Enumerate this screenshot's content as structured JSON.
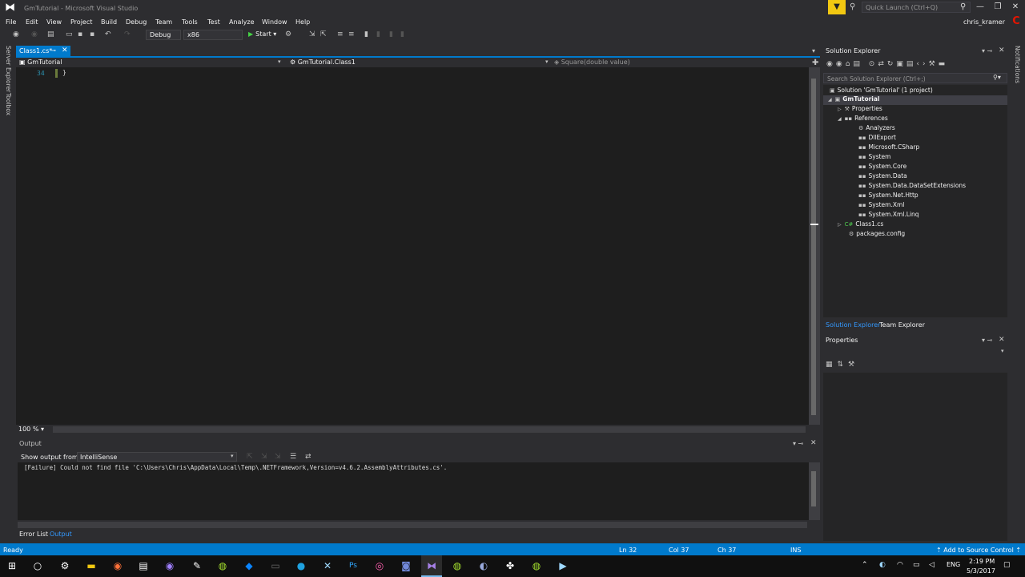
{
  "window": {
    "title": "GmTutorial - Microsoft Visual Studio",
    "quick_launch_placeholder": "Quick Launch (Ctrl+Q)"
  },
  "menu": [
    "File",
    "Edit",
    "View",
    "Project",
    "Build",
    "Debug",
    "Team",
    "Tools",
    "Test",
    "Analyze",
    "Window",
    "Help"
  ],
  "account": {
    "user": "chris_kramer"
  },
  "toolbar": {
    "configuration": "Debug",
    "platform": "x86",
    "start_label": "Start"
  },
  "left_strip": {
    "server_explorer": "Server Explorer",
    "toolbox": "Toolbox"
  },
  "editor": {
    "tab_label": "Class1.cs*",
    "nav_project": "GmTutorial",
    "nav_class": "GmTutorial.Class1",
    "nav_member": "Square(double value)",
    "line_number": "34",
    "code": "}",
    "zoom": "100 %"
  },
  "output": {
    "title": "Output",
    "show_from_label": "Show output from:",
    "source": "IntelliSense",
    "text": "[Failure] Could not find file 'C:\\Users\\Chris\\AppData\\Local\\Temp\\.NETFramework,Version=v4.6.2.AssemblyAttributes.cs'."
  },
  "bottom_tabs": {
    "error_list": "Error List",
    "output": "Output"
  },
  "solution_explorer": {
    "title": "Solution Explorer",
    "search_placeholder": "Search Solution Explorer (Ctrl+;)",
    "tree": [
      {
        "label": "Solution 'GmTutorial' (1 project)"
      },
      {
        "label": "GmTutorial"
      },
      {
        "label": "Properties"
      },
      {
        "label": "References"
      },
      {
        "label": "Analyzers"
      },
      {
        "label": "DllExport"
      },
      {
        "label": "Microsoft.CSharp"
      },
      {
        "label": "System"
      },
      {
        "label": "System.Core"
      },
      {
        "label": "System.Data"
      },
      {
        "label": "System.Data.DataSetExtensions"
      },
      {
        "label": "System.Net.Http"
      },
      {
        "label": "System.Xml"
      },
      {
        "label": "System.Xml.Linq"
      },
      {
        "label": "Class1.cs"
      },
      {
        "label": "packages.config"
      }
    ],
    "tab_solution_explorer": "Solution Explorer",
    "tab_team_explorer": "Team Explorer"
  },
  "properties": {
    "title": "Properties"
  },
  "right_strip": {
    "notifications": "Notifications"
  },
  "status": {
    "ready": "Ready",
    "ln": "Ln 32",
    "col": "Col 37",
    "ch": "Ch 37",
    "ins": "INS",
    "source_control": "Add to Source Control"
  },
  "taskbar": {
    "language": "ENG",
    "time": "2:19 PM",
    "date": "5/3/2017"
  },
  "colors": {
    "accent": "#007acc",
    "background": "#2d2d30",
    "editor": "#1e1e1e"
  }
}
